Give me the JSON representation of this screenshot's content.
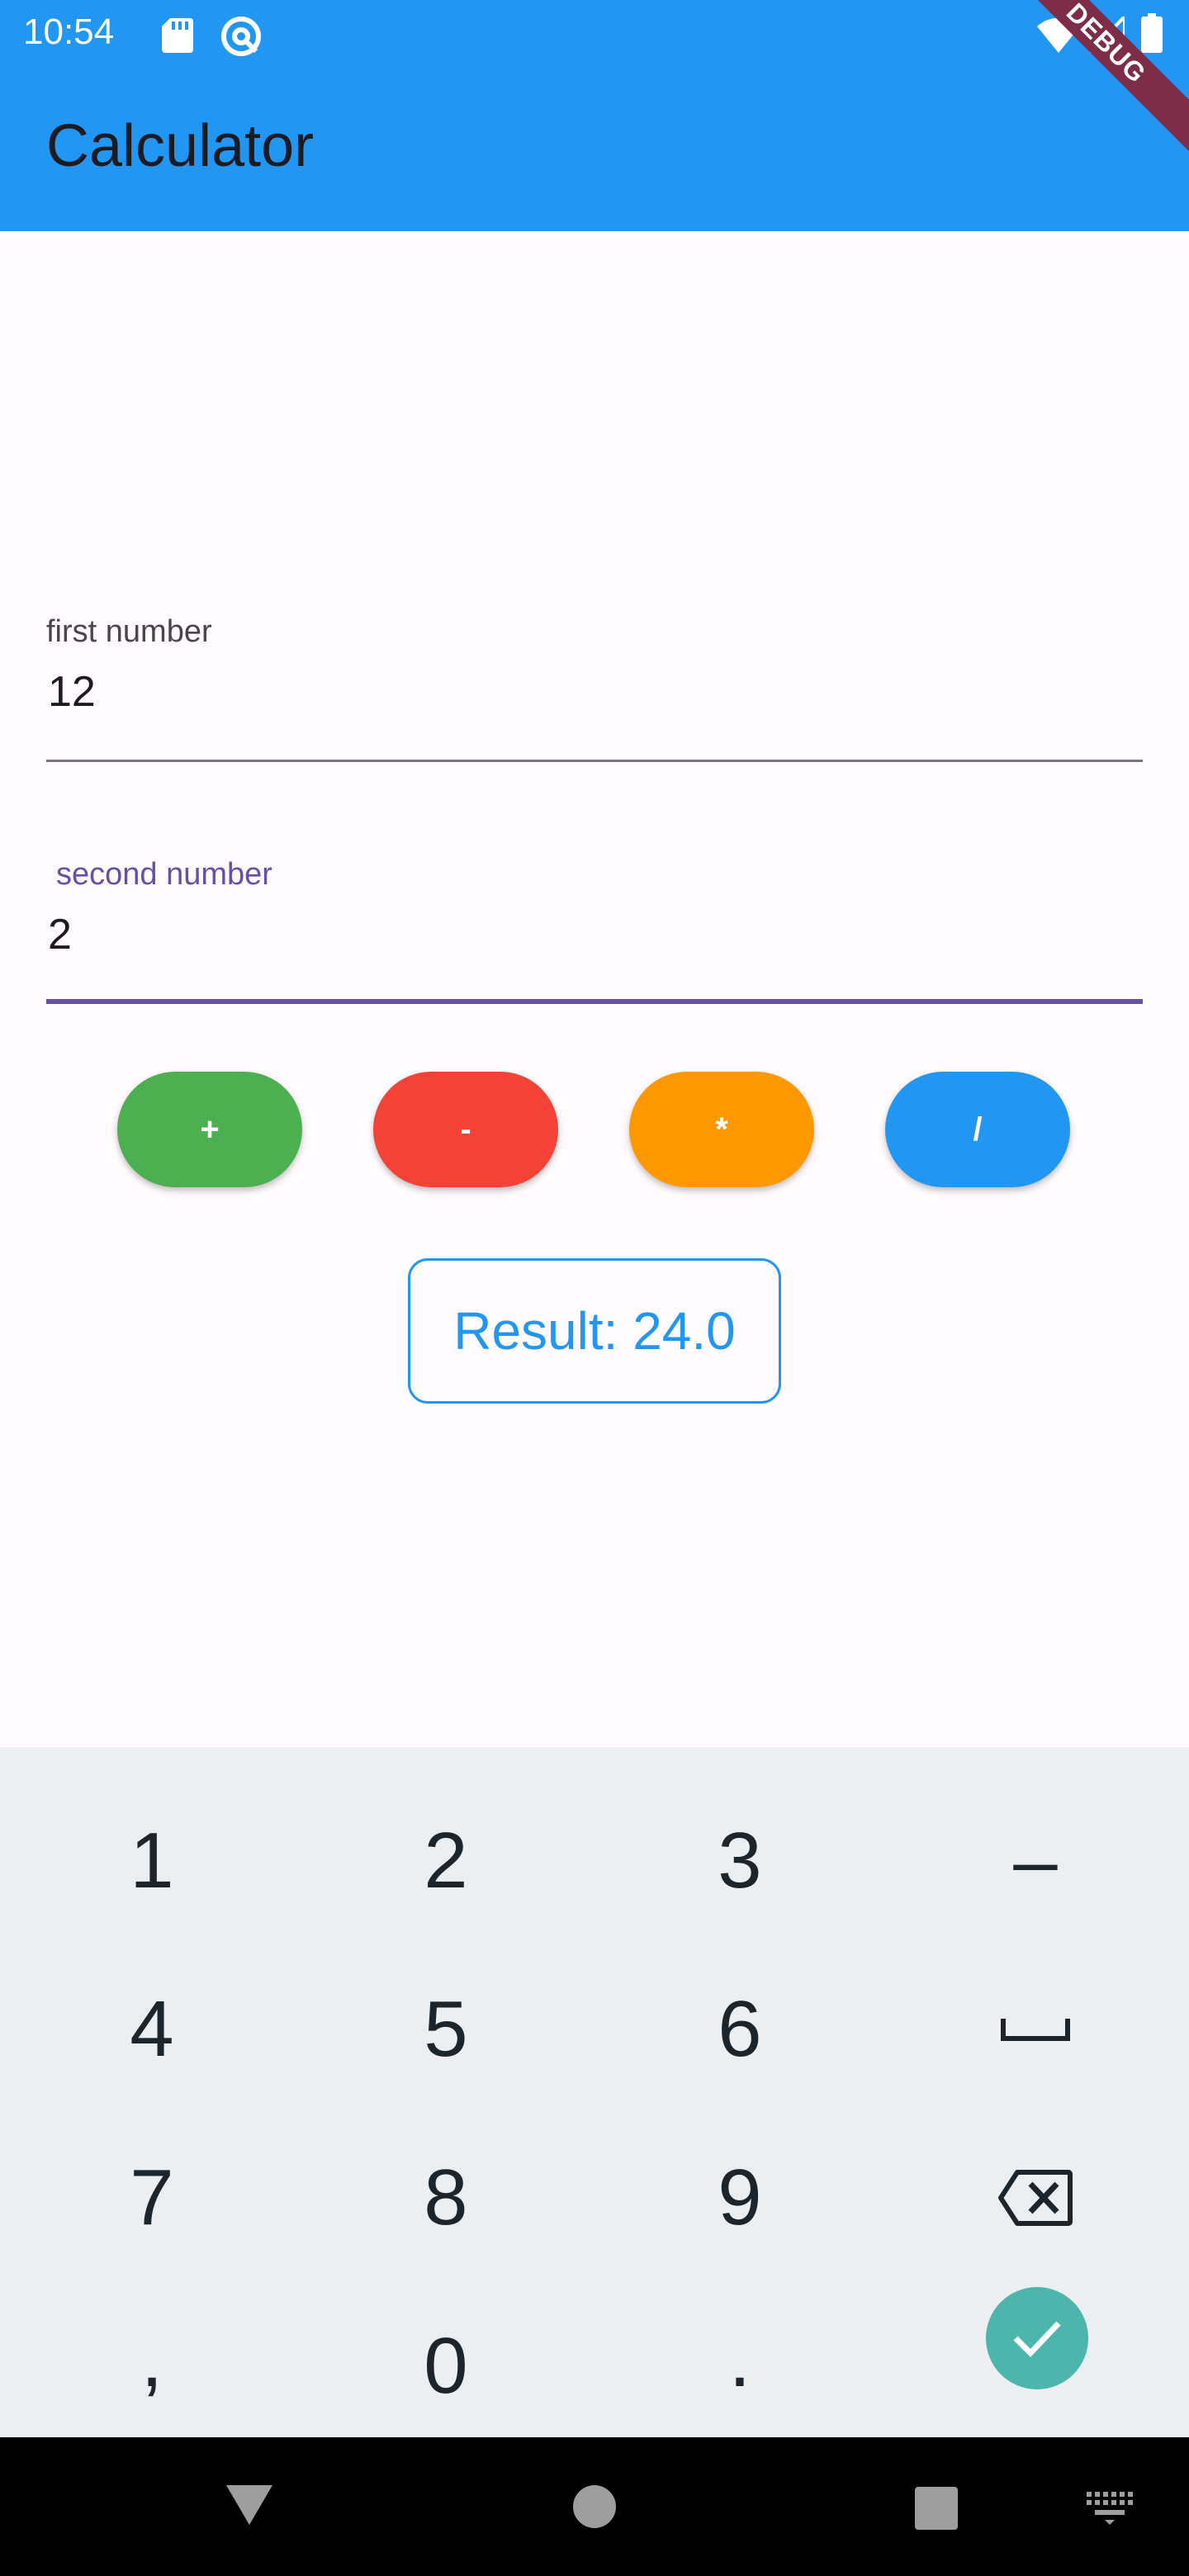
{
  "status_bar": {
    "time": "10:54",
    "icons": [
      "sd-card-icon",
      "at-sign-icon",
      "wifi-icon",
      "signal-icon",
      "battery-icon"
    ]
  },
  "app_bar": {
    "title": "Calculator",
    "color": "#2196f3"
  },
  "debug_banner": "DEBUG",
  "form": {
    "first": {
      "label": "first number",
      "value": "12"
    },
    "second": {
      "label": "second number",
      "value": "2",
      "focused": true,
      "accent": "#6750a4"
    }
  },
  "operations": [
    {
      "label": "+",
      "color": "#4caf50"
    },
    {
      "label": "-",
      "color": "#f44336"
    },
    {
      "label": "*",
      "color": "#ff9800"
    },
    {
      "label": "/",
      "color": "#2196f3"
    }
  ],
  "result": "Result: 24.0",
  "keyboard": {
    "rows": [
      [
        "1",
        "2",
        "3",
        "–"
      ],
      [
        "4",
        "5",
        "6",
        "␣"
      ],
      [
        "7",
        "8",
        "9",
        "backspace"
      ],
      [
        ",",
        "0",
        ".",
        "done"
      ]
    ],
    "done_color": "#4db6ac"
  },
  "nav_bar": [
    "back-icon",
    "home-icon",
    "recents-icon",
    "keyboard-switch-icon"
  ]
}
